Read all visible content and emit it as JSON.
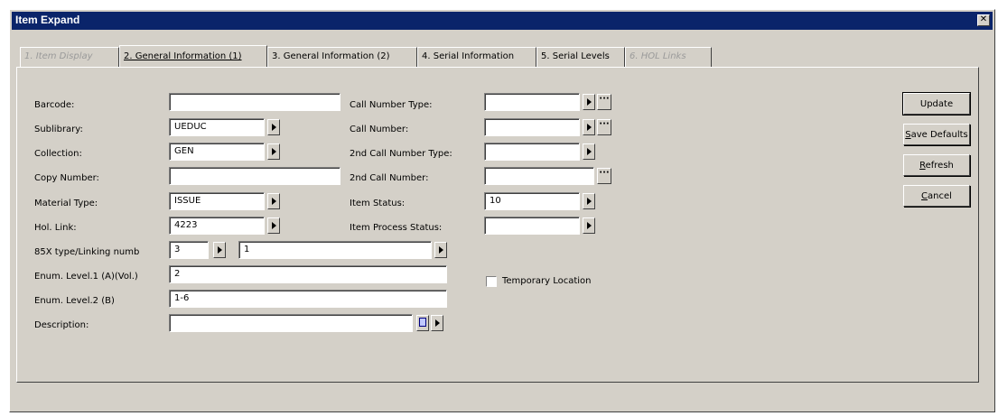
{
  "window": {
    "title": "Item Expand",
    "close_symbol": "✕"
  },
  "tabs": [
    {
      "label": "1. Item Display",
      "state": "disabled"
    },
    {
      "label": "2. General Information (1)",
      "state": "active"
    },
    {
      "label": "3. General Information (2)",
      "state": "normal"
    },
    {
      "label": "4. Serial Information",
      "state": "normal"
    },
    {
      "label": "5. Serial Levels",
      "state": "normal"
    },
    {
      "label": "6. HOL Links",
      "state": "disabled"
    }
  ],
  "left_form": {
    "barcode": {
      "label": "Barcode:",
      "value": ""
    },
    "sublibrary": {
      "label": "Sublibrary:",
      "value": "UEDUC"
    },
    "collection": {
      "label": "Collection:",
      "value": "GEN"
    },
    "copy_number": {
      "label": "Copy Number:",
      "value": ""
    },
    "material_type": {
      "label": "Material Type:",
      "value": "ISSUE"
    },
    "hol_link": {
      "label": "Hol. Link:",
      "value": "4223"
    },
    "linking": {
      "label": "85X type/Linking numb",
      "type_value": "3",
      "number_value": "1"
    },
    "enum_level_1": {
      "label": "Enum. Level.1 (A)(Vol.)",
      "value": "2"
    },
    "enum_level_2": {
      "label": "Enum. Level.2  (B)",
      "value": "1-6"
    },
    "description": {
      "label": "Description:",
      "value": ""
    }
  },
  "right_form": {
    "call_number_type": {
      "label": "Call Number Type:",
      "value": ""
    },
    "call_number": {
      "label": "Call Number:",
      "value": ""
    },
    "second_call_number_type": {
      "label": "2nd Call Number Type:",
      "value": ""
    },
    "second_call_number": {
      "label": "2nd Call Number:",
      "value": ""
    },
    "item_status": {
      "label": "Item Status:",
      "value": "10"
    },
    "item_process_status": {
      "label": "Item Process Status:",
      "value": ""
    },
    "temporary_location": {
      "label": "Temporary Location",
      "checked": false
    }
  },
  "ellipsis_symbol": "···",
  "buttons": {
    "update": "Update",
    "save_defaults_mn": "S",
    "save_defaults_rest": "ave Defaults",
    "refresh_mn": "R",
    "refresh_rest": "efresh",
    "cancel_mn": "C",
    "cancel_rest": "ancel"
  },
  "colors": {
    "titlebar": "#0a246a",
    "face": "#d4d0c8"
  }
}
